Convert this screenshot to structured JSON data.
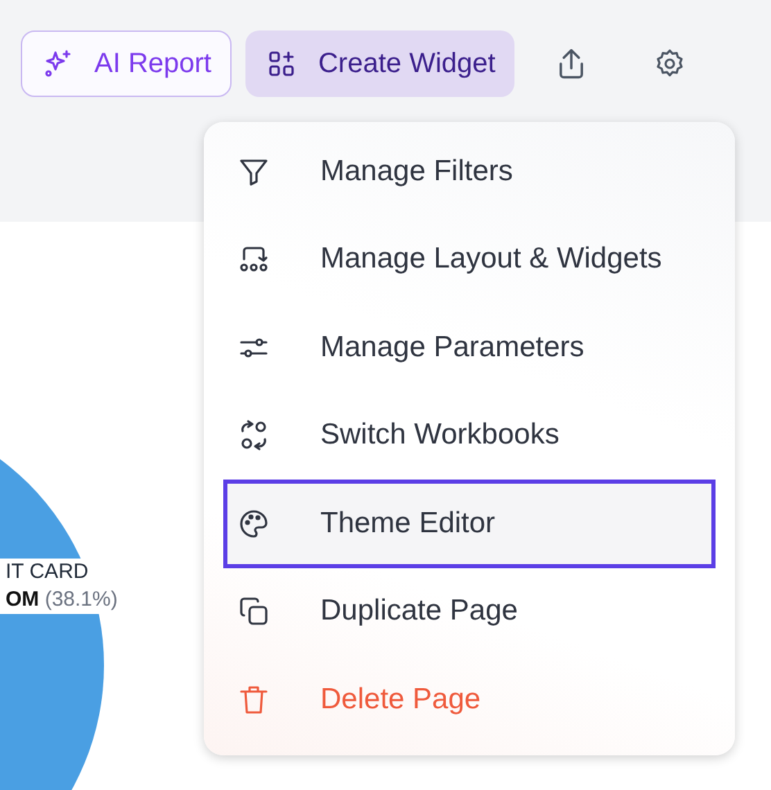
{
  "toolbar": {
    "buttons": [
      {
        "kind": "outline",
        "label": "AI Report"
      },
      {
        "kind": "filled",
        "label": "Create Widget"
      },
      {
        "kind": "icon-share"
      },
      {
        "kind": "icon-settings"
      }
    ]
  },
  "chart_panel": {
    "slice_label": {
      "name": "IT CARD",
      "value": "**OM** (38.1%)"
    }
  },
  "menu": {
    "items": [
      {
        "label": "Manage Filters",
        "kind": "normal",
        "selected": false
      },
      {
        "label": "Manage Layout & Widgets",
        "kind": "normal",
        "selected": false
      },
      {
        "label": "Manage Parameters",
        "kind": "normal",
        "selected": false
      },
      {
        "label": "Switch Workbooks",
        "kind": "normal",
        "selected": false
      },
      {
        "label": "Theme Editor",
        "kind": "normal",
        "selected": true
      },
      {
        "label": "Duplicate Page",
        "kind": "normal",
        "selected": false
      },
      {
        "label": "Delete Page",
        "kind": "danger",
        "selected": false
      }
    ]
  }
}
